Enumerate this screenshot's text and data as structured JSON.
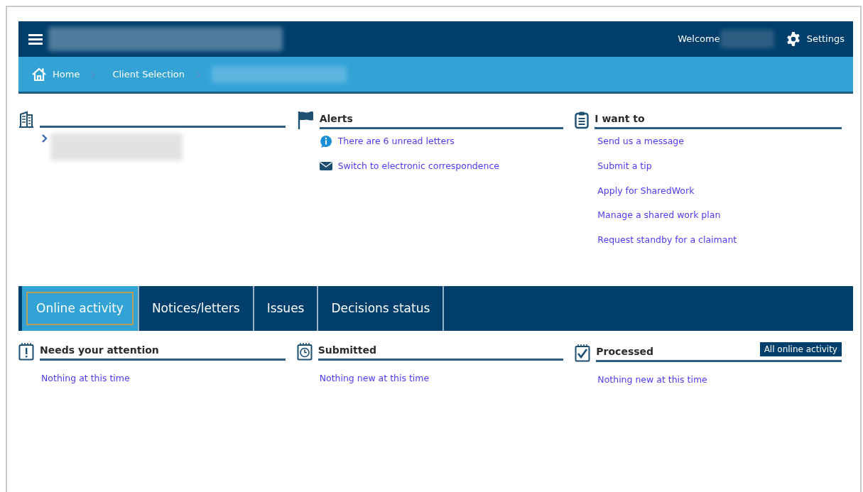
{
  "header": {
    "welcome": "Welcome",
    "settings": "Settings"
  },
  "breadcrumb": [
    "Home",
    "Client Selection"
  ],
  "panels": [
    {
      "kind": "client"
    },
    {
      "kind": "alerts",
      "title": "Alerts",
      "links": [
        {
          "kind": "info",
          "text": "There are 6 unread letters"
        },
        {
          "kind": "mail",
          "text": "Switch to electronic correspondence"
        }
      ]
    },
    {
      "kind": "actions",
      "title": "I want to",
      "links": [
        {
          "text": "Send us a message"
        },
        {
          "text": "Submit a tip"
        },
        {
          "text": "Apply for SharedWork"
        },
        {
          "text": "Manage a shared work plan"
        },
        {
          "text": "Request standby for a claimant"
        }
      ]
    }
  ],
  "tabs": [
    {
      "label": "Online activity",
      "selected": true
    },
    {
      "label": "Notices/letters",
      "selected": false
    },
    {
      "label": "Issues",
      "selected": false
    },
    {
      "label": "Decisions status",
      "selected": false
    }
  ],
  "activity": [
    {
      "kind": "attention",
      "title": "Needs your attention",
      "message": "Nothing at this time"
    },
    {
      "kind": "submitted",
      "title": "Submitted",
      "message": "Nothing new at this time"
    },
    {
      "kind": "processed",
      "title": "Processed",
      "message": "Nothing new at this time",
      "button": "All online activity"
    }
  ]
}
